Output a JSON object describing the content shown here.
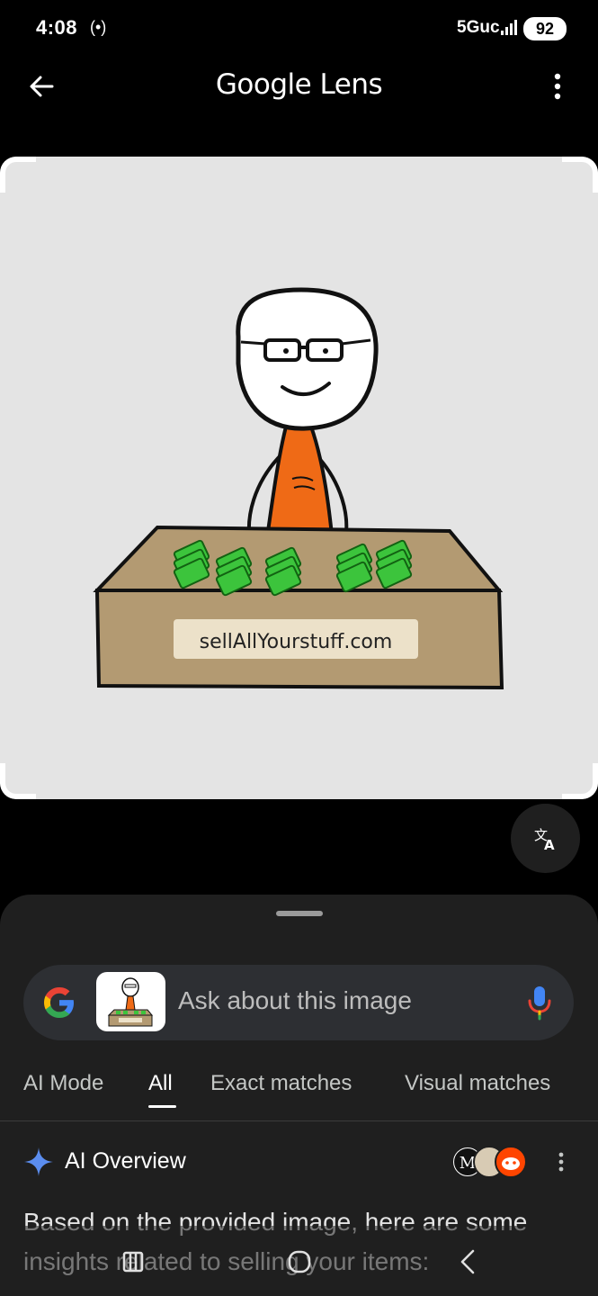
{
  "status_bar": {
    "time": "4:08",
    "cast_indicator": "(•)",
    "network": "5Guc",
    "battery": "92"
  },
  "app_bar": {
    "title": "Google Lens",
    "back_icon": "arrow-left-icon",
    "more_icon": "more-vert-icon"
  },
  "image": {
    "sign_text": "sellAllYourstuff.com"
  },
  "translate_icon": "translate-icon",
  "search": {
    "placeholder": "Ask about this image"
  },
  "tabs": [
    {
      "label": "AI Mode"
    },
    {
      "label": "All"
    },
    {
      "label": "Exact matches"
    },
    {
      "label": "Visual matches"
    }
  ],
  "active_tab": "All",
  "ai_overview": {
    "title": "AI Overview",
    "body": "Based on the provided image, here are some insights related to selling your items:"
  },
  "colors": {
    "background": "#000000",
    "sheet": "#1f1f1f",
    "search_box": "#2d2f33",
    "google_blue": "#4285f4",
    "google_red": "#ea4335",
    "google_yellow": "#fbbc05",
    "google_green": "#34a853"
  }
}
